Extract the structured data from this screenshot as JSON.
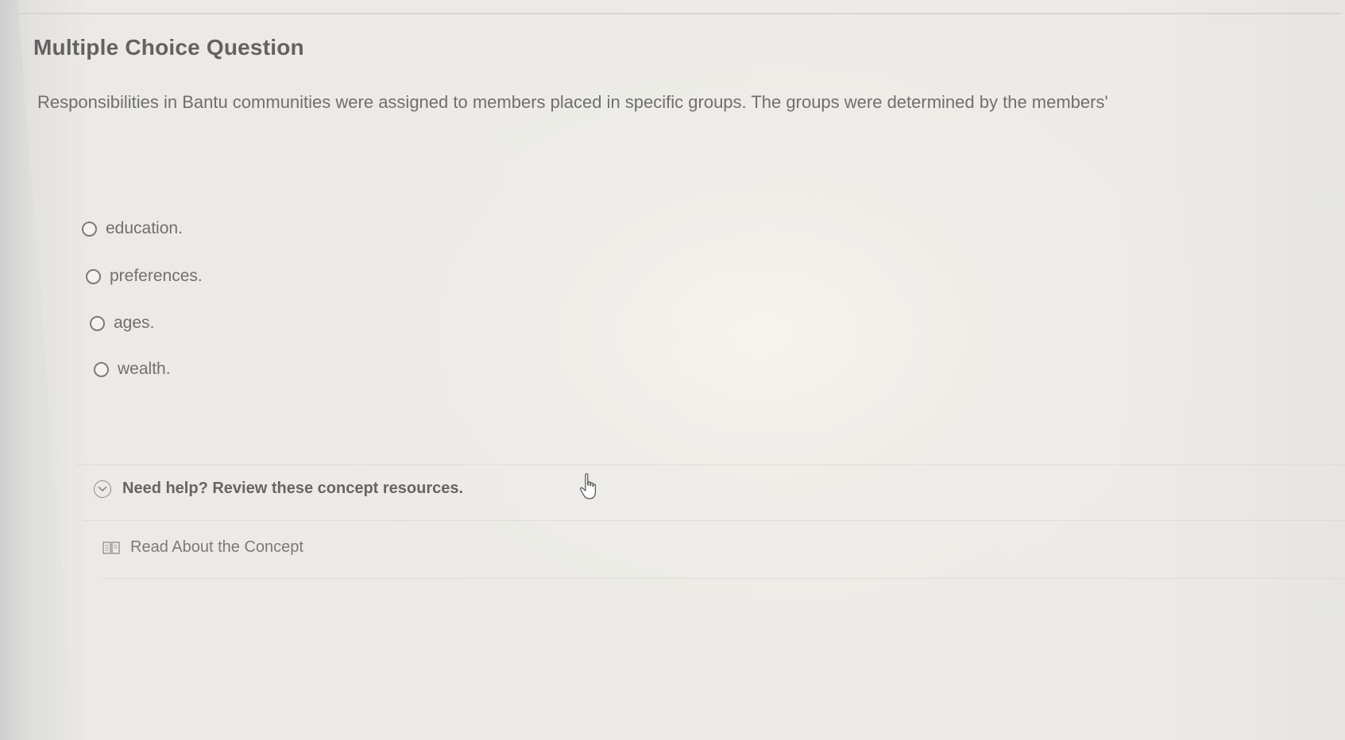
{
  "header": {
    "title": "Multiple Choice Question"
  },
  "question": {
    "text": "Responsibilities in Bantu communities were assigned to members placed in specific groups. The groups were determined by the members'"
  },
  "options": [
    {
      "label": "education.",
      "selected": false
    },
    {
      "label": "preferences.",
      "selected": false
    },
    {
      "label": "ages.",
      "selected": false
    },
    {
      "label": "wealth.",
      "selected": false
    }
  ],
  "help": {
    "toggle_label": "Need help? Review these concept resources.",
    "toggle_icon": "chevron-down-circle-icon",
    "resources": [
      {
        "label": "Read About the Concept",
        "icon": "book-icon"
      }
    ]
  },
  "pointer": {
    "icon": "hand-pointer-icon"
  }
}
